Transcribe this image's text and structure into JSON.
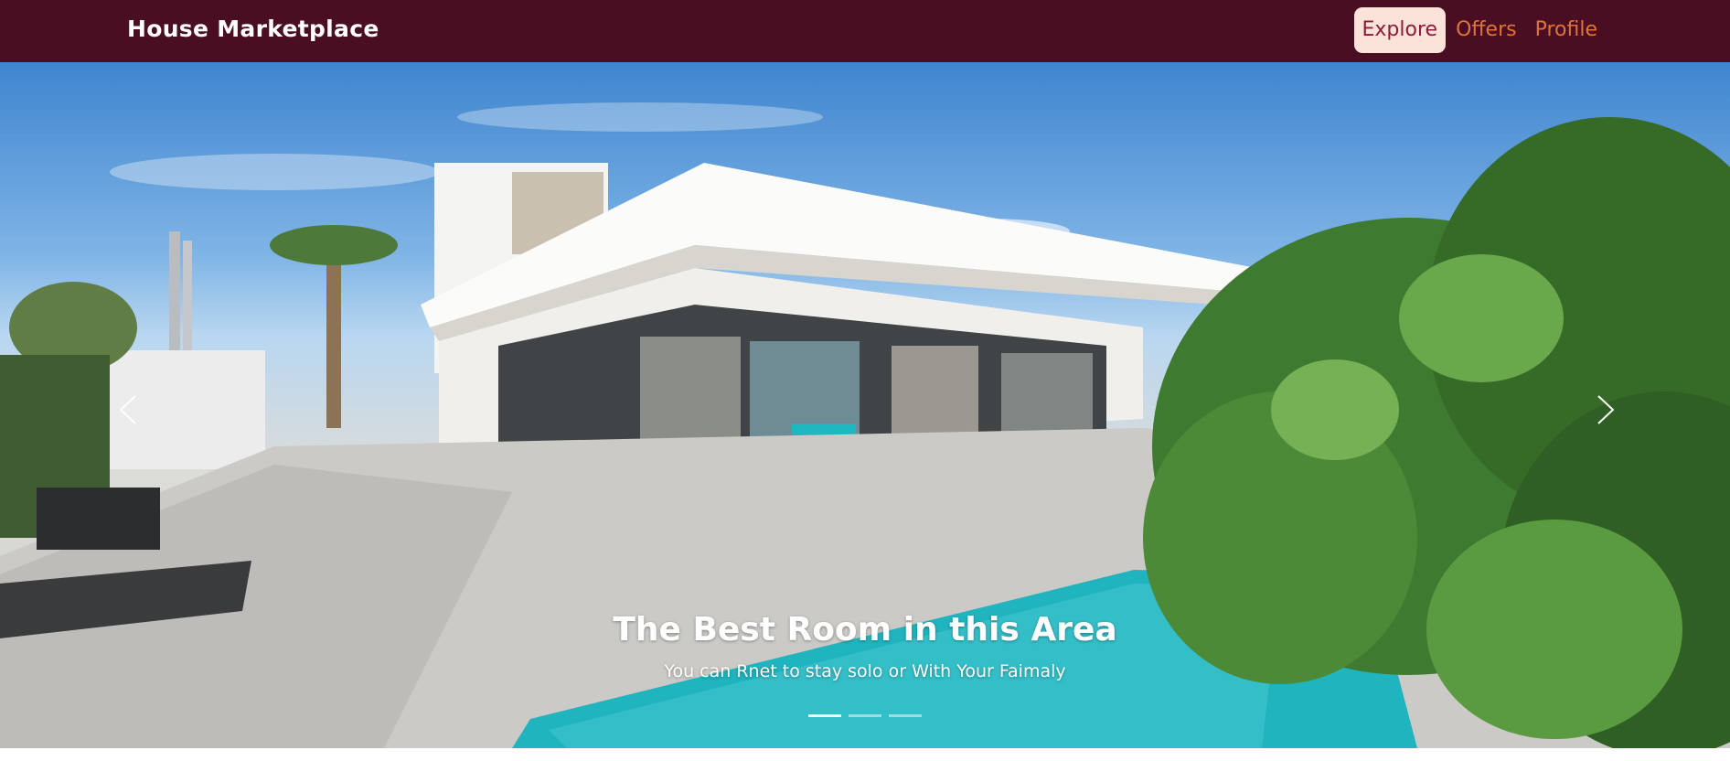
{
  "navbar": {
    "brand": "House Marketplace",
    "links": [
      {
        "label": "Explore",
        "active": true
      },
      {
        "label": "Offers",
        "active": false
      },
      {
        "label": "Profile",
        "active": false
      }
    ]
  },
  "carousel": {
    "slides": [
      {
        "title": "The Best Room in this Area",
        "subtitle": "You can Rnet to stay solo or With Your Faimaly"
      }
    ],
    "active_index": 0,
    "indicator_count": 3
  },
  "colors": {
    "navbar_bg": "#4a0e22",
    "link_color": "#e0733a",
    "active_link_bg": "#fbe3d9",
    "active_link_color": "#8c1c3a"
  }
}
